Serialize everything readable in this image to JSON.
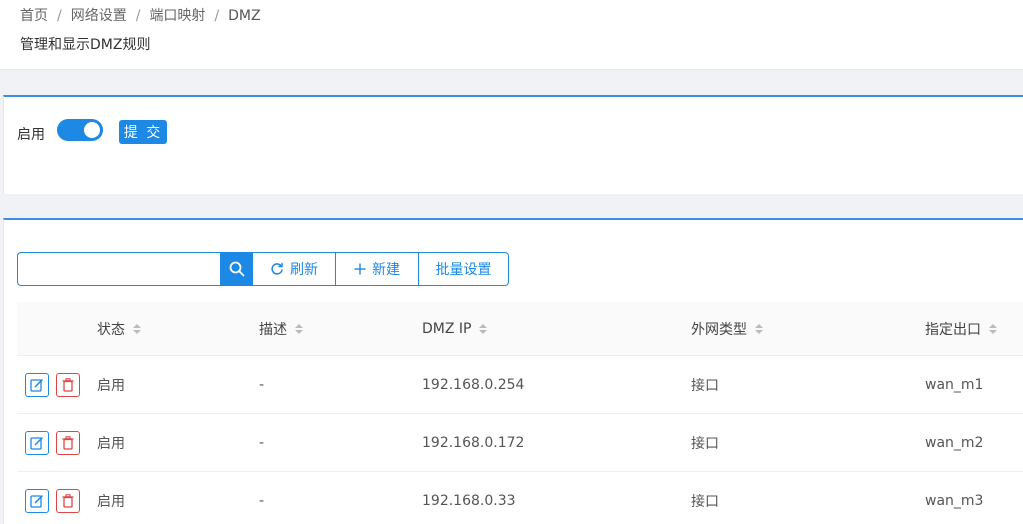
{
  "breadcrumb": {
    "items": [
      "首页",
      "网络设置",
      "端口映射",
      "DMZ"
    ],
    "separator": "/"
  },
  "page": {
    "description": "管理和显示DMZ规则"
  },
  "enable_section": {
    "label": "启用",
    "toggle_on": true,
    "submit_label": "提 交"
  },
  "toolbar": {
    "search_value": "",
    "refresh_label": "刷新",
    "new_label": "新建",
    "batch_label": "批量设置"
  },
  "table": {
    "columns": [
      "状态",
      "描述",
      "DMZ IP",
      "外网类型",
      "指定出口"
    ],
    "rows": [
      {
        "status": "启用",
        "desc": "-",
        "ip": "192.168.0.254",
        "wan_type": "接口",
        "outlet": "wan_m1"
      },
      {
        "status": "启用",
        "desc": "-",
        "ip": "192.168.0.172",
        "wan_type": "接口",
        "outlet": "wan_m2"
      },
      {
        "status": "启用",
        "desc": "-",
        "ip": "192.168.0.33",
        "wan_type": "接口",
        "outlet": "wan_m3"
      }
    ]
  },
  "colors": {
    "accent": "#1e88e5",
    "danger": "#e04545"
  }
}
